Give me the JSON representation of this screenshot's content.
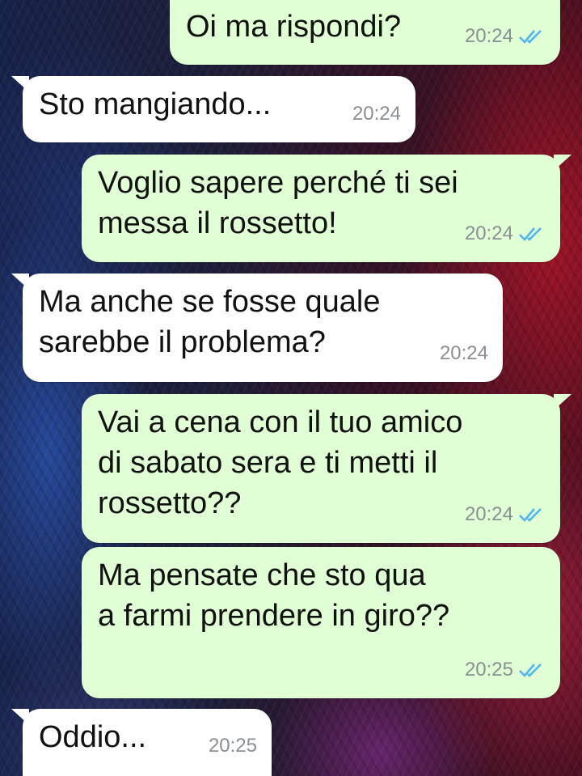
{
  "messages": [
    {
      "text": "Oi ma rispondi?",
      "time": "20:24",
      "direction": "outgoing",
      "status": "read"
    },
    {
      "text": "Sto mangiando...",
      "time": "20:24",
      "direction": "incoming"
    },
    {
      "text": "Voglio sapere perché ti sei\nmessa il rossetto!",
      "time": "20:24",
      "direction": "outgoing",
      "status": "read"
    },
    {
      "text": "Ma anche se fosse quale\nsarebbe il problema?",
      "time": "20:24",
      "direction": "incoming"
    },
    {
      "text": "Vai a cena con il tuo amico\ndi sabato sera e ti metti il\nrossetto??",
      "time": "20:24",
      "direction": "outgoing",
      "status": "read"
    },
    {
      "text": "Ma pensate che sto qua\na farmi prendere in giro??",
      "time": "20:25",
      "direction": "outgoing",
      "status": "read"
    },
    {
      "text": "Oddio...",
      "time": "20:25",
      "direction": "incoming"
    }
  ],
  "colors": {
    "outgoing_bubble": "#e1ffd4",
    "incoming_bubble": "#ffffff",
    "read_ticks": "#4fb6ec",
    "timestamp": "#8a8f93"
  },
  "icons": {
    "read_receipt": "double-check-icon"
  }
}
